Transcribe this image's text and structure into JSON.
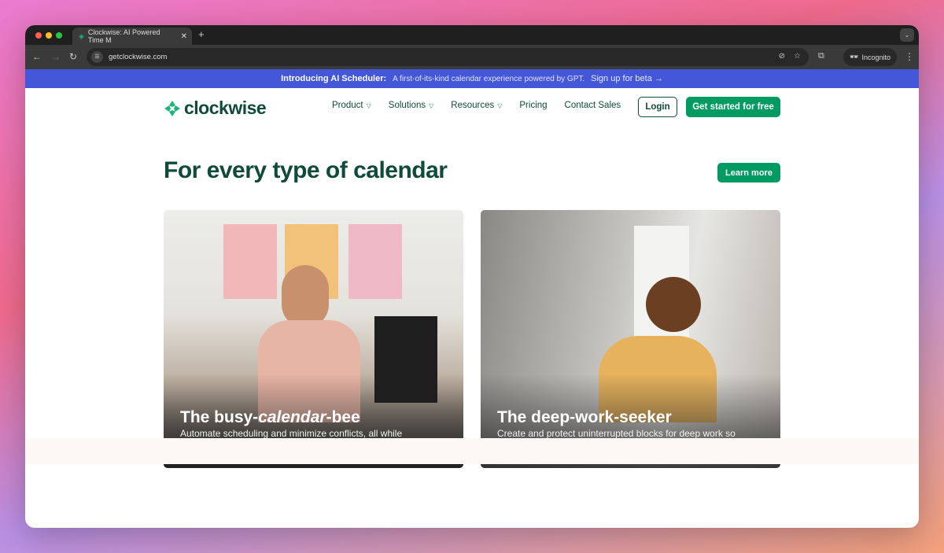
{
  "browser": {
    "tab_title": "Clockwise: AI Powered Time M",
    "url": "getclockwise.com",
    "incognito_label": "Incognito"
  },
  "banner": {
    "title": "Introducing AI Scheduler:",
    "text": "A first-of-its-kind calendar experience powered by GPT.",
    "link": "Sign up for beta →"
  },
  "nav": {
    "logo": "clockwise",
    "items": [
      {
        "label": "Product",
        "dropdown": true
      },
      {
        "label": "Solutions",
        "dropdown": true
      },
      {
        "label": "Resources",
        "dropdown": true
      },
      {
        "label": "Pricing"
      },
      {
        "label": "Contact Sales"
      }
    ],
    "login": "Login",
    "cta": "Get started for free"
  },
  "hero": {
    "title": "For every type of calendar",
    "learn_more": "Learn more"
  },
  "cards": [
    {
      "title_pre": "The busy-",
      "title_em": "calendar",
      "title_post": "-bee",
      "desc": "Automate scheduling and minimize conflicts, all while maintaining your work day preferences."
    },
    {
      "title": "The deep-work-seeker",
      "desc": "Create and protect uninterrupted blocks for deep work so you can find your flow and focus."
    }
  ],
  "colors": {
    "brand": "#0f4a3a",
    "accent": "#009b62",
    "banner": "#4357d8"
  }
}
